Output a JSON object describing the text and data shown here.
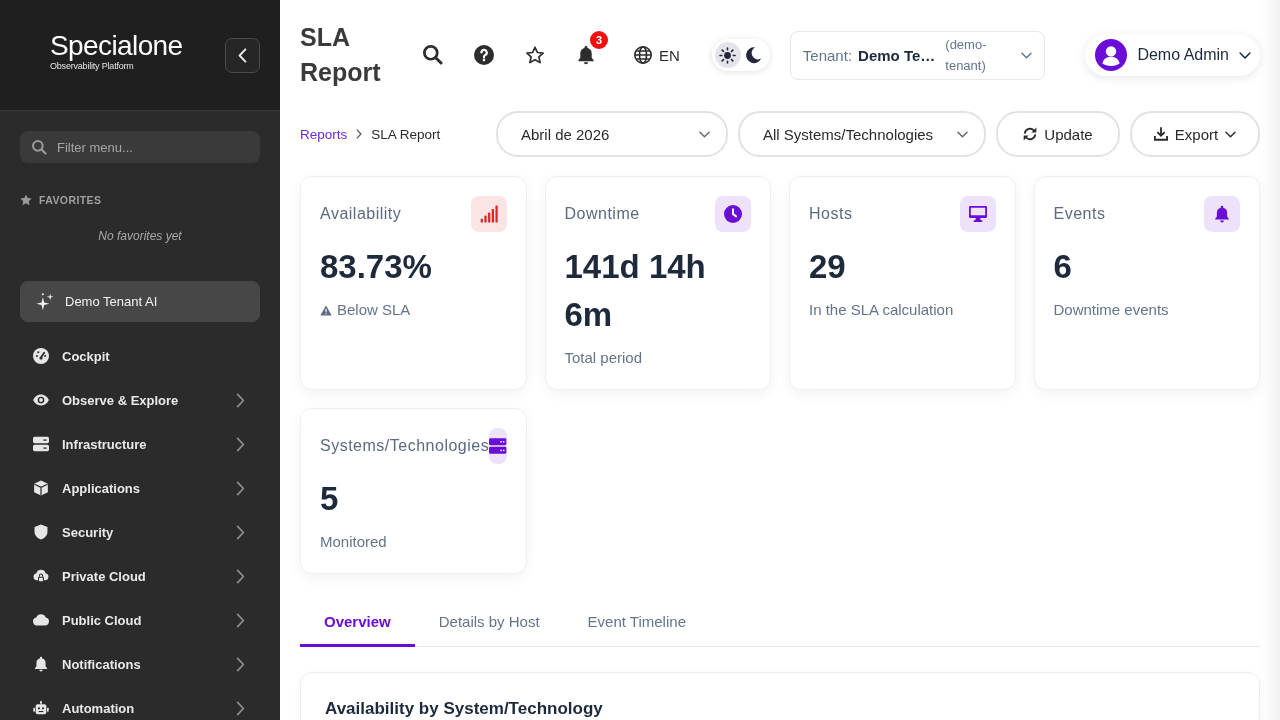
{
  "sidebar": {
    "logo": {
      "name": "Specialone",
      "tagline": "Observability Platform"
    },
    "filter": {
      "placeholder": "Filter menu..."
    },
    "favorites": {
      "heading": "FAVORITES",
      "empty_text": "No favorites yet"
    },
    "ai_button": {
      "label": "Demo Tenant AI"
    },
    "items": [
      {
        "label": "Cockpit",
        "has_submenu": false
      },
      {
        "label": "Observe & Explore",
        "has_submenu": true
      },
      {
        "label": "Infrastructure",
        "has_submenu": true
      },
      {
        "label": "Applications",
        "has_submenu": true
      },
      {
        "label": "Security",
        "has_submenu": true
      },
      {
        "label": "Private Cloud",
        "has_submenu": true
      },
      {
        "label": "Public Cloud",
        "has_submenu": true
      },
      {
        "label": "Notifications",
        "has_submenu": true
      },
      {
        "label": "Automation",
        "has_submenu": true
      }
    ]
  },
  "header": {
    "title": "SLA Report",
    "notifications": {
      "badge": "3"
    },
    "language": "EN",
    "theme_toggle": [
      {
        "selected": true
      },
      {
        "selected": false
      }
    ],
    "tenant": {
      "label": "Tenant:",
      "name": "Demo Te…",
      "slug": "(demo-tenant)"
    },
    "user": {
      "name": "Demo Admin"
    }
  },
  "breadcrumb": [
    {
      "label": "Reports",
      "current": false
    },
    {
      "label": "SLA Report",
      "current": true
    }
  ],
  "filters": [
    {
      "value": "Abril de 2026"
    },
    {
      "value": "All Systems/Technologies"
    }
  ],
  "actions": [
    {
      "label": "Update",
      "has_menu": false
    },
    {
      "label": "Export",
      "has_menu": true
    }
  ],
  "cards": [
    {
      "title": "Availability",
      "color": "#e02424",
      "value": "83.73%",
      "note": "Below SLA",
      "warning": true
    },
    {
      "title": "Downtime",
      "color": "#6a0dd6",
      "value": "141d 14h 6m",
      "note": "Total period",
      "warning": false
    },
    {
      "title": "Hosts",
      "color": "#6a0dd6",
      "value": "29",
      "note": "In the SLA calculation",
      "warning": false
    },
    {
      "title": "Events",
      "color": "#6a0dd6",
      "value": "6",
      "note": "Downtime events",
      "warning": false
    },
    {
      "title": "Systems/Technologies",
      "color": "#6a0dd6",
      "value": "5",
      "note": "Monitored",
      "warning": false
    }
  ],
  "tabs": [
    {
      "label": "Overview",
      "selected": true
    },
    {
      "label": "Details by Host",
      "selected": false
    },
    {
      "label": "Event Timeline",
      "selected": false
    }
  ],
  "section": {
    "title": "Availability by System/Technology"
  }
}
